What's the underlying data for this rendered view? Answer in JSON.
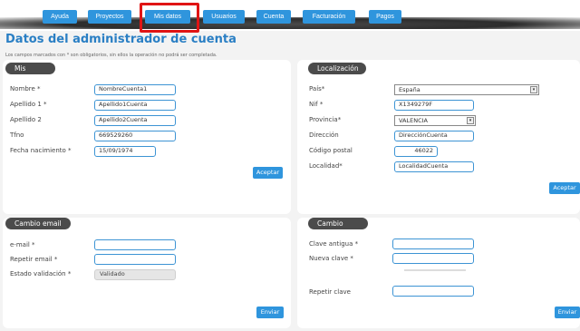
{
  "nav": {
    "tabs": [
      {
        "label": "Ayuda"
      },
      {
        "label": "Proyectos"
      },
      {
        "label": "Mis datos"
      },
      {
        "label": "Usuarios"
      },
      {
        "label": "Cuenta"
      },
      {
        "label": "Facturación"
      },
      {
        "label": "Pagos"
      }
    ],
    "active": "Mis datos"
  },
  "page": {
    "title": "Datos del administrador de cuenta",
    "note": "Los campos marcados con * son obligatorios, sin ellos la operación no podrá ser completada."
  },
  "mis_datos": {
    "title": "Mis datos",
    "fields": [
      {
        "label": "Nombre *",
        "value": "NombreCuenta1"
      },
      {
        "label": "Apellido 1 *",
        "value": "Apellido1Cuenta"
      },
      {
        "label": "Apellido 2",
        "value": "Apellido2Cuenta"
      },
      {
        "label": "Tfno",
        "value": "669529260"
      },
      {
        "label": "Fecha nacimiento *",
        "value": "15/09/1974"
      }
    ],
    "button": "Aceptar"
  },
  "localizacion": {
    "title": "Localización",
    "fields": [
      {
        "label": "País*",
        "value": "España"
      },
      {
        "label": "Nif *",
        "value": "X1349279F"
      },
      {
        "label": "Provincia*",
        "value": "VALENCIA"
      },
      {
        "label": "Dirección",
        "value": "DirecciónCuenta"
      },
      {
        "label": "Código postal",
        "value": "46022"
      },
      {
        "label": "Localidad*",
        "value": "LocalidadCuenta"
      }
    ],
    "button": "Aceptar"
  },
  "cambio_email": {
    "title": "Cambio email",
    "fields": [
      {
        "label": "e-mail *",
        "value": ""
      },
      {
        "label": "Repetir email *",
        "value": ""
      },
      {
        "label": "Estado validación *",
        "value": "Validado"
      }
    ],
    "button": "Enviar"
  },
  "cambio_clave": {
    "title": "Cambio clave",
    "fields": [
      {
        "label": "Clave antigua *",
        "value": ""
      },
      {
        "label": "Nueva clave *",
        "value": ""
      },
      {
        "label": "Repetir clave",
        "value": ""
      }
    ],
    "button": "Enviar"
  },
  "colors": {
    "accent": "#2f95dd",
    "title": "#2a7fc4",
    "highlight": "#e01414",
    "panel_header": "#4b4b4b"
  }
}
